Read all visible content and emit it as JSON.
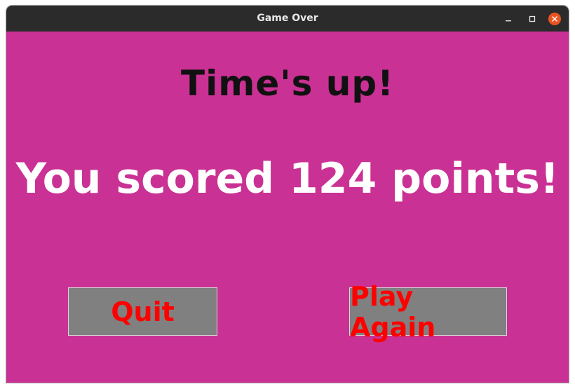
{
  "window": {
    "title": "Game Over",
    "controls": [
      "minimize-icon",
      "maximize-icon",
      "close-icon"
    ]
  },
  "game": {
    "headline": "Time's up!",
    "score_message": "You scored 124 points!",
    "score": 124
  },
  "buttons": {
    "quit_label": "Quit",
    "play_again_label": "Play Again"
  },
  "colors": {
    "background": "#ca3194",
    "titlebar": "#2b2b2b",
    "headline_text": "#111111",
    "score_text": "#ffffff",
    "button_bg": "#808080",
    "button_text": "#ff0000",
    "close_button": "#e95420"
  }
}
